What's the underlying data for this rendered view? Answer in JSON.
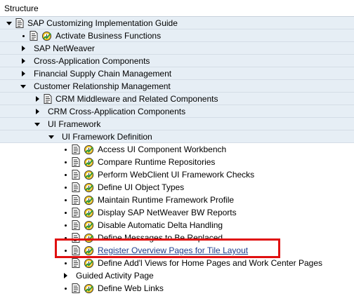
{
  "header": {
    "title": "Structure"
  },
  "tree": [
    {
      "label": "SAP Customizing Implementation Guide",
      "expander": "down",
      "doc": true,
      "clock": false
    },
    {
      "label": "Activate Business Functions",
      "expander": "bullet",
      "doc": true,
      "clock": true
    },
    {
      "label": "SAP NetWeaver",
      "expander": "right",
      "doc": false,
      "clock": false
    },
    {
      "label": "Cross-Application Components",
      "expander": "right",
      "doc": false,
      "clock": false
    },
    {
      "label": "Financial Supply Chain Management",
      "expander": "right",
      "doc": false,
      "clock": false
    },
    {
      "label": "Customer Relationship Management",
      "expander": "down",
      "doc": false,
      "clock": false
    },
    {
      "label": "CRM Middleware and Related Components",
      "expander": "right",
      "doc": true,
      "clock": false
    },
    {
      "label": "CRM Cross-Application Components",
      "expander": "right",
      "doc": false,
      "clock": false
    },
    {
      "label": "UI Framework",
      "expander": "down",
      "doc": false,
      "clock": false
    },
    {
      "label": "UI Framework Definition",
      "expander": "down",
      "doc": false,
      "clock": false
    },
    {
      "label": "Access UI Component Workbench",
      "expander": "bullet",
      "doc": true,
      "clock": true
    },
    {
      "label": "Compare Runtime Repositories",
      "expander": "bullet",
      "doc": true,
      "clock": true
    },
    {
      "label": "Perform WebClient UI Framework Checks",
      "expander": "bullet",
      "doc": true,
      "clock": true
    },
    {
      "label": "Define UI Object Types",
      "expander": "bullet",
      "doc": true,
      "clock": true
    },
    {
      "label": "Maintain Runtime Framework Profile",
      "expander": "bullet",
      "doc": true,
      "clock": true
    },
    {
      "label": "Display SAP NetWeaver BW Reports",
      "expander": "bullet",
      "doc": true,
      "clock": true
    },
    {
      "label": "Disable Automatic Delta Handling",
      "expander": "bullet",
      "doc": true,
      "clock": true
    },
    {
      "label": "Define Messages to Be Replaced",
      "expander": "bullet",
      "doc": true,
      "clock": true
    },
    {
      "label": "Register Overview Pages for Tile Layout",
      "expander": "bullet",
      "doc": true,
      "clock": true,
      "link": true,
      "highlighted": true
    },
    {
      "label": "Define Add'l Views for Home Pages and Work Center Pages",
      "expander": "bullet",
      "doc": true,
      "clock": true
    },
    {
      "label": "Guided Activity Page",
      "expander": "right",
      "doc": false,
      "clock": false
    },
    {
      "label": "Define Web Links",
      "expander": "bullet",
      "doc": true,
      "clock": true
    }
  ],
  "colors": {
    "band": "#e6eef5",
    "highlight": "#e01010",
    "link": "#1f3d8c",
    "clock_green": "#2e9a2e",
    "clock_yellow": "#f2c21b"
  }
}
